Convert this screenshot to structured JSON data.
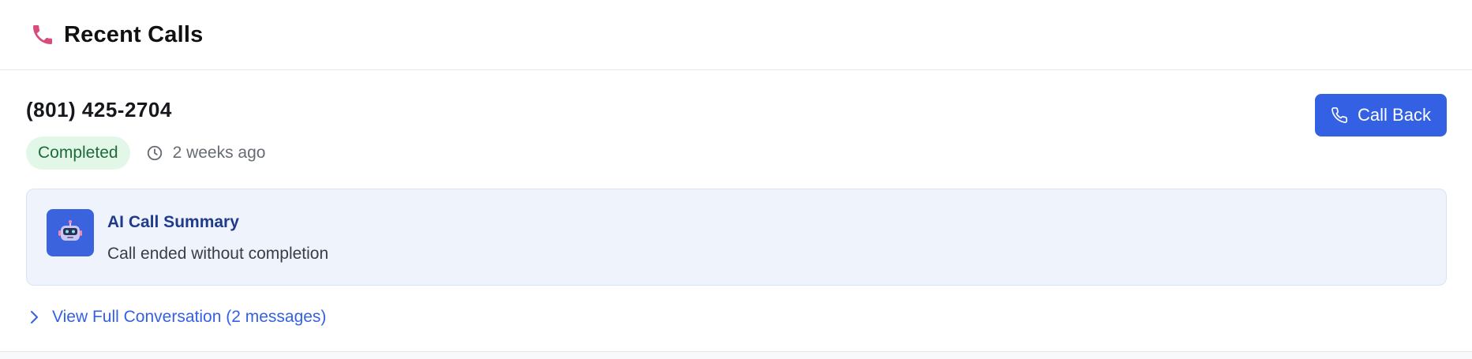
{
  "header": {
    "icon": "phone-icon",
    "title": "Recent Calls"
  },
  "call": {
    "number": "(801) 425-2704",
    "status": "Completed",
    "time_icon": "clock-icon",
    "time": "2 weeks ago"
  },
  "actions": {
    "call_back_icon": "phone-outline-icon",
    "call_back_label": "Call Back"
  },
  "summary": {
    "icon": "robot-icon",
    "title": "AI Call Summary",
    "text": "Call ended without completion"
  },
  "conversation": {
    "icon": "chevron-right-icon",
    "label": "View Full Conversation (2 messages)"
  },
  "colors": {
    "accent": "#3461e3",
    "badge_bg": "#e3f7e9",
    "badge_text": "#1e6b3a",
    "summary_bg": "#eef3fc",
    "summary_title": "#1f3a8a",
    "phone_icon": "#d94b7a"
  }
}
